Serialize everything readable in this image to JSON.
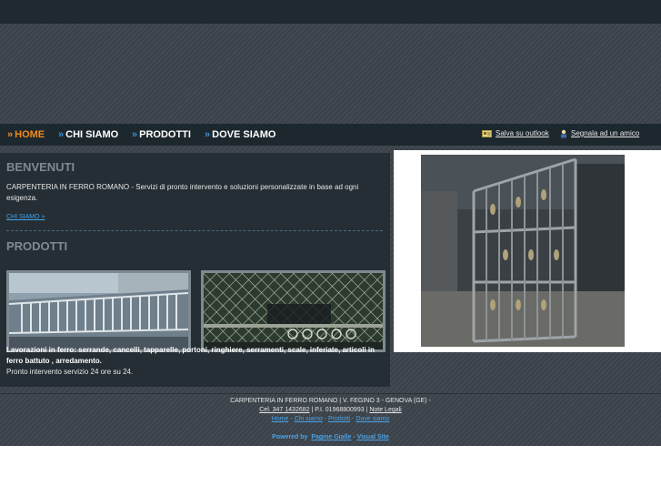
{
  "nav": {
    "items": [
      {
        "label": "HOME",
        "active": true
      },
      {
        "label": "CHI SIAMO",
        "active": false
      },
      {
        "label": "PRODOTTI",
        "active": false
      },
      {
        "label": "DOVE SIAMO",
        "active": false
      }
    ],
    "arrow": "»",
    "tools": {
      "outlook": "Salva su outlook",
      "friend": "Segnala ad un amico"
    }
  },
  "welcome": {
    "title": "BENVENUTI",
    "text": "CARPENTERIA IN FERRO ROMANO - Servizi di pronto intervento e soluzioni personalizzate in base ad ogni esigenza.",
    "link": "CHI SIAMO »"
  },
  "products": {
    "title": "PRODOTTI",
    "text_bold": "Lavorazioni in ferro: serrande, cancelli, tapparelle, portoni, ringhiere, serramenti, scale, inferiate, articoli in ferro battuto , arredamento.",
    "text_extra": "Pronto intervento servizio 24 ore su 24."
  },
  "footer": {
    "line1": "CARPENTERIA IN FERRO ROMANO | V. FEGINO 3 - GENOVA (GE) -",
    "phone": "Cel. 347 1432682",
    "vat": " | P.I. 01968800993 | ",
    "legal": "Note Legali",
    "links": [
      "Home",
      "Chi siamo",
      "Prodotti",
      "Dove siamo"
    ],
    "sep": " - ",
    "powered": "Powered by",
    "pg": "Pagine Gialle",
    "vs": "Visual Site"
  },
  "colors": {
    "accent": "#f28a1a",
    "link": "#4aa2e8",
    "bg": "#3a4148"
  }
}
